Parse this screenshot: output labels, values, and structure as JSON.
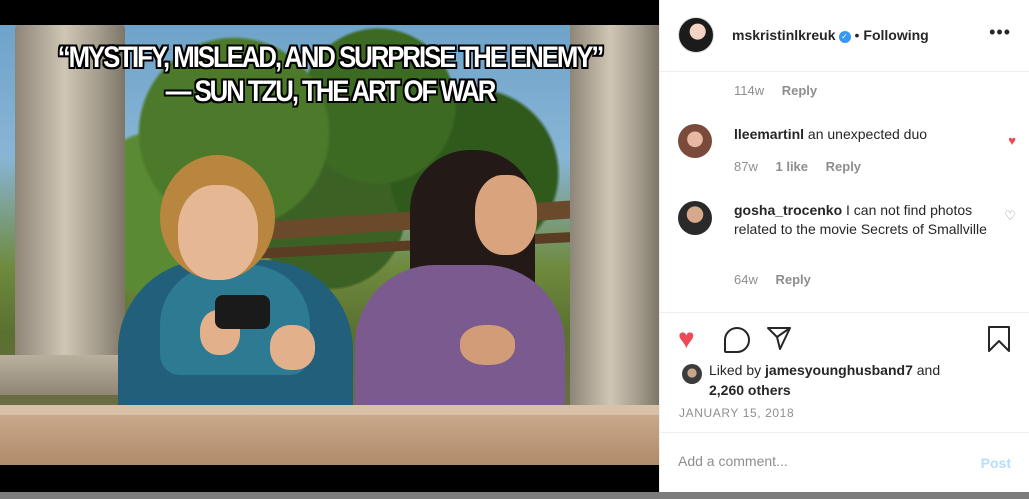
{
  "post": {
    "caption_line1": "“MYSTIFY, MISLEAD, AND SURPRISE THE ENEMY”",
    "caption_line2": "— SUN TZU, THE ART OF WAR"
  },
  "header": {
    "username": "mskristinlkreuk",
    "verified_icon": "✓",
    "separator": "•",
    "follow_status": "Following",
    "more_icon": "•••"
  },
  "comments": {
    "prev_meta": {
      "time": "114w",
      "reply": "Reply"
    },
    "items": [
      {
        "username": "lleemartinl",
        "text": " an unexpected duo",
        "time": "87w",
        "likes": "1 like",
        "reply": "Reply",
        "heart": "♥"
      },
      {
        "username": "gosha_trocenko",
        "text": " I can not find photos related to the movie Secrets of Smallville",
        "time": "64w",
        "reply": "Reply",
        "heart": "♡"
      }
    ]
  },
  "actions": {
    "like_icon": "♥",
    "like_color": "#ed4956"
  },
  "likes": {
    "prefix": "Liked by ",
    "user": "jamesyounghusband7",
    "suffix": " and",
    "others": "2,260 others"
  },
  "date": "JANUARY 15, 2018",
  "composer": {
    "placeholder": "Add a comment...",
    "post_label": "Post",
    "post_color": "#b2dffc"
  }
}
